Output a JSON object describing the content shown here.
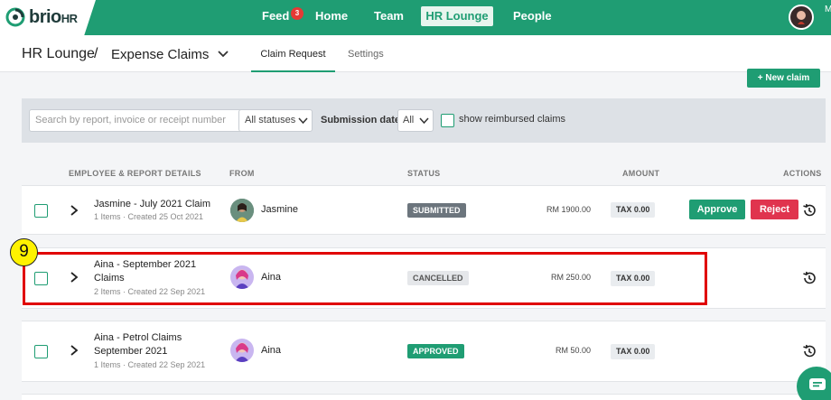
{
  "app": {
    "logo_text": "brio",
    "logo_suffix": "HR",
    "user_initial": "M",
    "accent_color": "#1f9d73"
  },
  "nav": {
    "feed": "Feed",
    "feed_badge": "3",
    "home": "Home",
    "team": "Team",
    "hr_lounge": "HR Lounge",
    "people": "People"
  },
  "breadcrumb": {
    "section": "HR Lounge",
    "separator": "/",
    "page": "Expense Claims"
  },
  "subtabs": {
    "claim_request": "Claim Request",
    "settings": "Settings"
  },
  "actions": {
    "new_claim": "+ New claim"
  },
  "filters": {
    "search_placeholder": "Search by report, invoice or receipt number",
    "status_value": "All statuses",
    "submission_label": "Submission date",
    "date_value": "All",
    "reimbursed_label": "show reimbursed claims"
  },
  "table": {
    "headers": {
      "details": "EMPLOYEE & REPORT DETAILS",
      "from": "FROM",
      "status": "STATUS",
      "amount": "AMOUNT",
      "actions": "ACTIONS"
    },
    "rows": [
      {
        "title_line1": "Jasmine - July 2021 Claim",
        "title_line2": "",
        "meta": "1 Items · Created 25 Oct 2021",
        "from": "Jasmine",
        "status": "SUBMITTED",
        "amount": "RM 1900.00",
        "tax": "TAX 0.00",
        "approve": "Approve",
        "reject": "Reject"
      },
      {
        "title_line1": "Aina - September 2021",
        "title_line2": "Claims",
        "meta": "2 Items · Created 22 Sep 2021",
        "from": "Aina",
        "status": "CANCELLED",
        "amount": "RM 250.00",
        "tax": "TAX 0.00"
      },
      {
        "title_line1": "Aina - Petrol Claims",
        "title_line2": "September 2021",
        "meta": "1 Items · Created 22 Sep 2021",
        "from": "Aina",
        "status": "APPROVED",
        "amount": "RM 50.00",
        "tax": "TAX 0.00"
      }
    ]
  },
  "annotation": {
    "number": "9"
  }
}
